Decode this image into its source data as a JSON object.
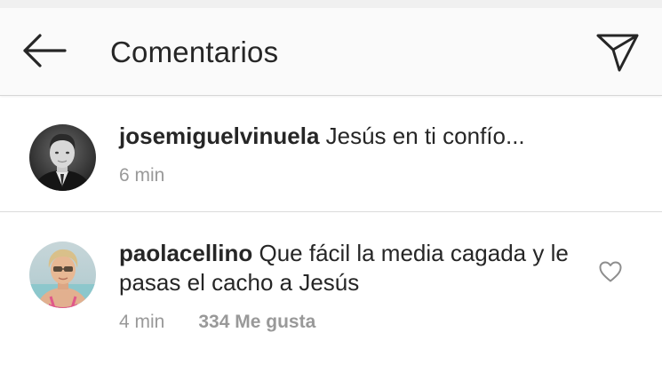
{
  "header": {
    "title": "Comentarios",
    "back_icon": "arrow-left-icon",
    "send_icon": "paper-plane-icon"
  },
  "comments": [
    {
      "username": "josemiguelvinuela",
      "text": "Jesús en ti confío...",
      "time": "6 min",
      "avatar_icon": "user-avatar"
    },
    {
      "username": "paolacellino",
      "text": "Que fácil la media cagada y le pasas el cacho a Jesús",
      "time": "4 min",
      "likes": "334 Me gusta",
      "avatar_icon": "user-avatar",
      "like_icon": "heart-outline-icon"
    }
  ],
  "colors": {
    "text": "#262626",
    "secondary": "#999999",
    "header_bg": "#fafafa",
    "divider": "#dbdbdb"
  }
}
